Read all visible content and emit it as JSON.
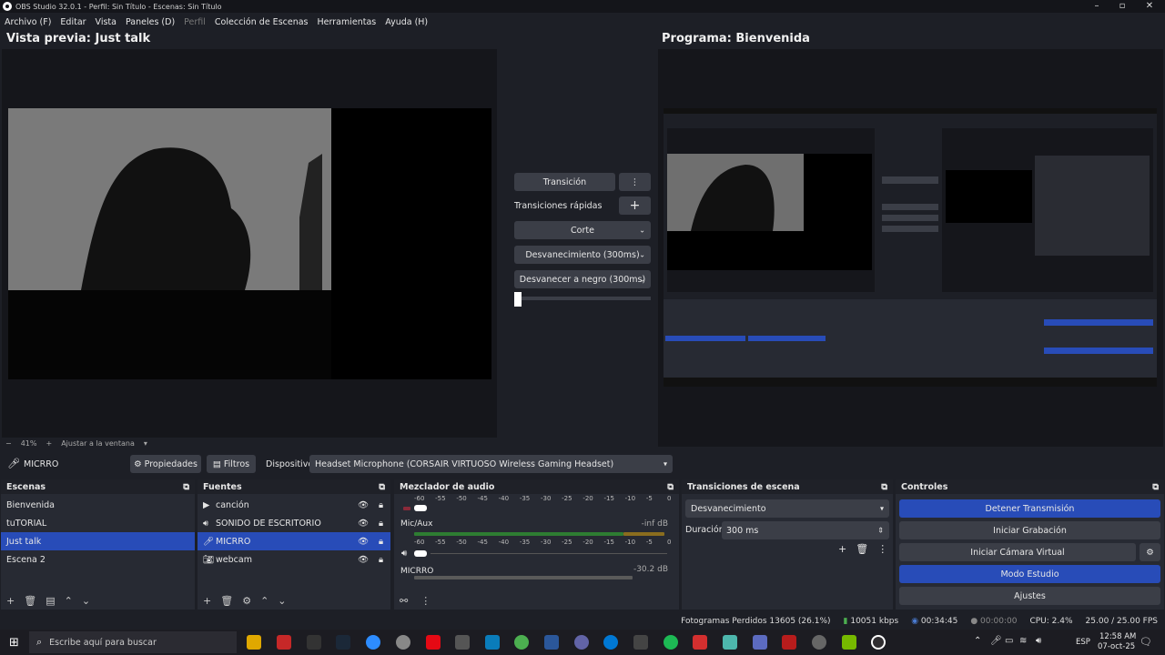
{
  "window": {
    "title": "OBS Studio 32.0.1 - Perfil: Sin Título - Escenas: Sin Título"
  },
  "menu": [
    "Archivo (F)",
    "Editar",
    "Vista",
    "Paneles (D)",
    "Perfil",
    "Colección de Escenas",
    "Herramientas",
    "Ayuda (H)"
  ],
  "preview": {
    "title": "Vista previa: Just talk",
    "zoom": "41%",
    "fit": "Ajustar a la ventana"
  },
  "program": {
    "title": "Programa: Bienvenida"
  },
  "transitions_mid": {
    "transition_label": "Transición",
    "quick_label": "Transiciones rápidas",
    "options": [
      "Corte",
      "Desvanecimiento (300ms)",
      "Desvanecer a negro (300ms)"
    ]
  },
  "sourcebar": {
    "source": "MICRRO",
    "properties": "Propiedades",
    "filters": "Filtros",
    "device_label": "Dispositivo",
    "device_value": "Headset Microphone (CORSAIR VIRTUOSO Wireless Gaming Headset)"
  },
  "scenes": {
    "title": "Escenas",
    "items": [
      "Bienvenida",
      "tuTORIAL",
      "Just talk",
      "Escena 2"
    ],
    "selected": 2
  },
  "sources": {
    "title": "Fuentes",
    "items": [
      "canción",
      "SONIDO DE ESCRITORIO",
      "MICRRO",
      "webcam"
    ],
    "selected": 2
  },
  "mixer": {
    "title": "Mezclador de audio",
    "ticks": [
      "-60",
      "-55",
      "-50",
      "-45",
      "-40",
      "-35",
      "-30",
      "-25",
      "-20",
      "-15",
      "-10",
      "-5",
      "0"
    ],
    "channels": [
      {
        "name": "Mic/Aux",
        "level": "-inf dB"
      },
      {
        "name": "MICRRO",
        "level": "-30.2 dB"
      }
    ]
  },
  "scene_transitions": {
    "title": "Transiciones de escena",
    "selected": "Desvanecimiento",
    "duration_label": "Duración",
    "duration_value": "300 ms"
  },
  "controls": {
    "title": "Controles",
    "buttons": [
      "Detener Transmisión",
      "Iniciar Grabación",
      "Iniciar Cámara Virtual",
      "Modo Estudio",
      "Ajustes"
    ]
  },
  "status": {
    "dropped": "Fotogramas Perdidos 13605 (26.1%)",
    "bitrate": "10051 kbps",
    "stream_time": "00:34:45",
    "record_time": "00:00:00",
    "cpu": "CPU: 2.4%",
    "fps": "25.00 / 25.00 FPS"
  },
  "taskbar": {
    "search_placeholder": "Escribe aquí para buscar",
    "lang": "ESP",
    "time": "12:58 AM",
    "date": "07-oct-25"
  },
  "colors": {
    "accent": "#284cb8",
    "panel": "#272a33",
    "bg": "#1d1f26"
  }
}
